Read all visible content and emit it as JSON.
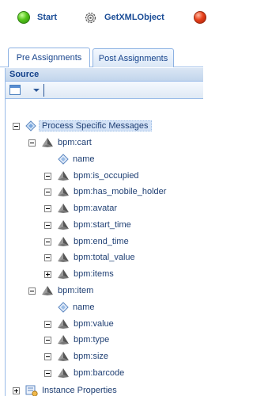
{
  "flow": {
    "start_label": "Start",
    "getxml_label": "GetXMLObject"
  },
  "tabs": {
    "pre": "Pre Assignments",
    "post": "Post Assignments"
  },
  "panel": {
    "title": "Source"
  },
  "tree": {
    "root": "Process Specific Messages",
    "cart": {
      "label": "bpm:cart",
      "children": [
        "name",
        "bpm:is_occupied",
        "bpm:has_mobile_holder",
        "bpm:avatar",
        "bpm:start_time",
        "bpm:end_time",
        "bpm:total_value",
        "bpm:items"
      ]
    },
    "item": {
      "label": "bpm:item",
      "children": [
        "name",
        "bpm:value",
        "bpm:type",
        "bpm:size",
        "bpm:barcode"
      ]
    },
    "instance": "Instance Properties"
  }
}
